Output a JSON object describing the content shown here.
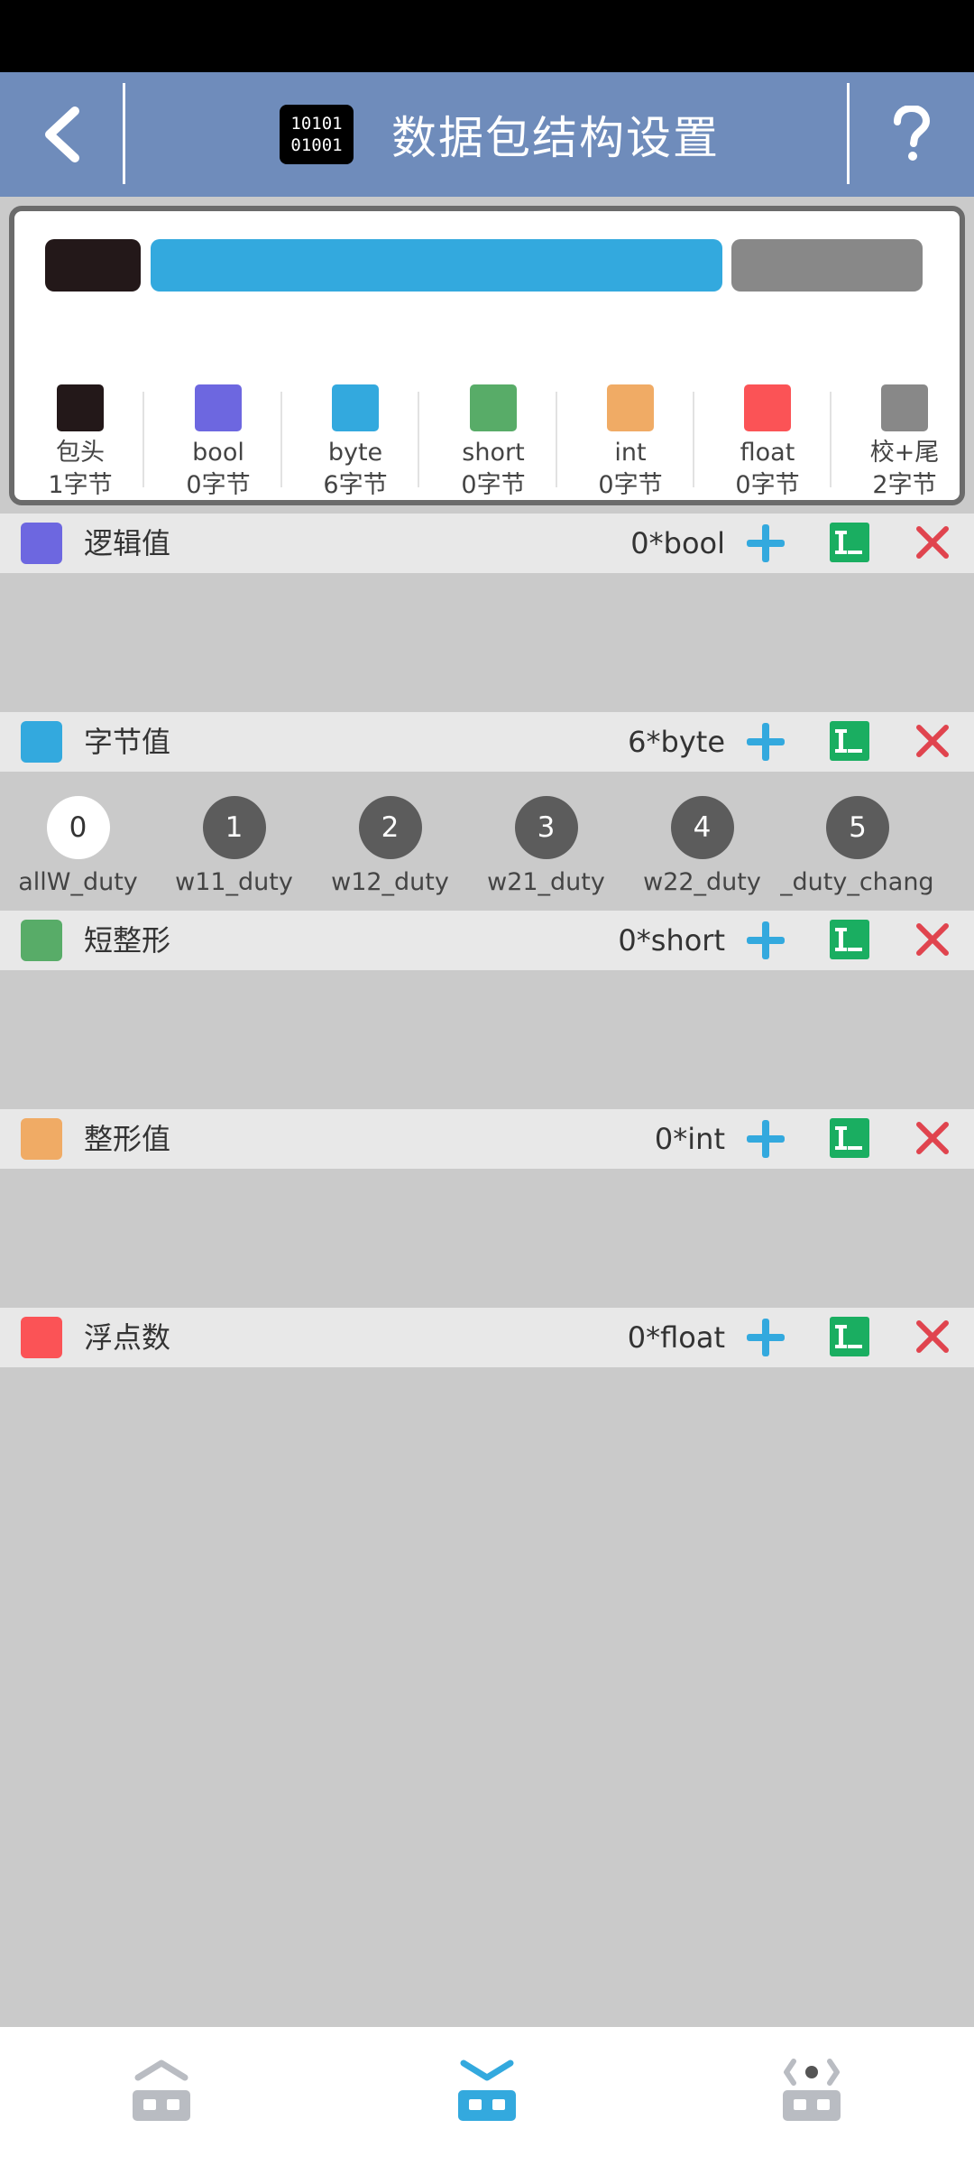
{
  "header": {
    "title": "数据包结构设置",
    "binary_icon_line1": "10101",
    "binary_icon_line2": "01001",
    "back_icon": "chevron-left-icon",
    "help_icon": "question-mark-icon",
    "background_color": "#6f8cbb"
  },
  "structure_bar": {
    "segments": [
      {
        "name": "包头",
        "color": "#231819",
        "bytes": 1
      },
      {
        "name": "byte",
        "color": "#33a9de",
        "bytes": 6
      },
      {
        "name": "校+尾",
        "color": "#888888",
        "bytes": 2
      }
    ]
  },
  "legend": [
    {
      "name": "包头",
      "bytes": "1字节",
      "color": "#231819"
    },
    {
      "name": "bool",
      "bytes": "0字节",
      "color": "#6d67e0"
    },
    {
      "name": "byte",
      "bytes": "6字节",
      "color": "#33a9de"
    },
    {
      "name": "short",
      "bytes": "0字节",
      "color": "#58ac68"
    },
    {
      "name": "int",
      "bytes": "0字节",
      "color": "#f0ab65"
    },
    {
      "name": "float",
      "bytes": "0字节",
      "color": "#fb5356"
    },
    {
      "name": "校+尾",
      "bytes": "2字节",
      "color": "#888888"
    }
  ],
  "sections": [
    {
      "title": "逻辑值",
      "count": "0*bool",
      "color": "#6d67e0"
    },
    {
      "title": "字节值",
      "count": "6*byte",
      "color": "#33a9de"
    },
    {
      "title": "短整形",
      "count": "0*short",
      "color": "#58ac68"
    },
    {
      "title": "整形值",
      "count": "0*int",
      "color": "#f0ab65"
    },
    {
      "title": "浮点数",
      "count": "0*float",
      "color": "#fb5356"
    }
  ],
  "byte_items": [
    {
      "index": "0",
      "name": "allW_duty",
      "selected": true
    },
    {
      "index": "1",
      "name": "w11_duty",
      "selected": false
    },
    {
      "index": "2",
      "name": "w12_duty",
      "selected": false
    },
    {
      "index": "3",
      "name": "w21_duty",
      "selected": false
    },
    {
      "index": "4",
      "name": "w22_duty",
      "selected": false
    },
    {
      "index": "5",
      "name": "_duty_change",
      "selected": false
    }
  ],
  "section_actions": {
    "add_icon": "plus-icon",
    "edit_icon": "rename-icon",
    "delete_icon": "close-icon",
    "add_color": "#33a9de",
    "edit_color": "#1aae61",
    "delete_color": "#e0444e"
  },
  "bottom_nav": [
    {
      "icon": "robot-up-icon",
      "active": false
    },
    {
      "icon": "robot-down-icon",
      "active": true
    },
    {
      "icon": "robot-code-icon",
      "active": false
    }
  ]
}
